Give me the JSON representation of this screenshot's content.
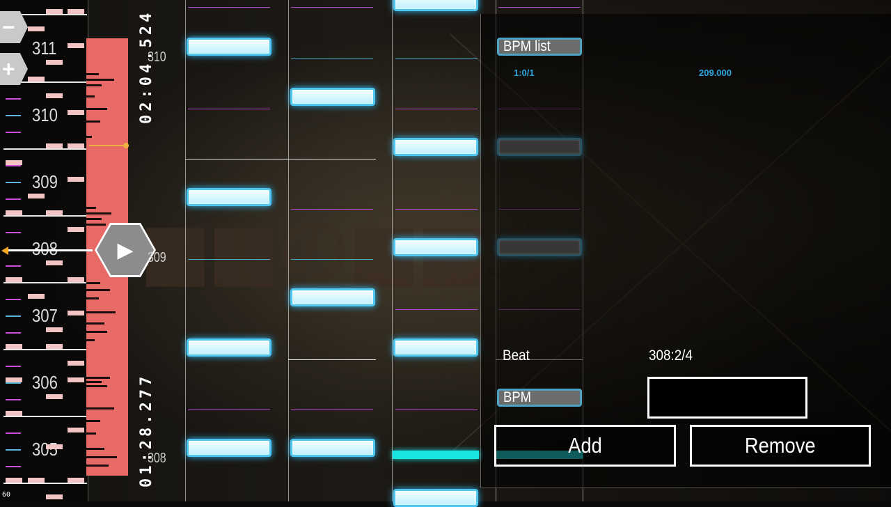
{
  "timeline": {
    "measures": [
      "311",
      "310",
      "309",
      "308",
      "307",
      "306",
      "305"
    ],
    "bottom_label": "60",
    "zoom_out_label": "−",
    "zoom_in_label": "+",
    "play_label": "▶"
  },
  "time_top": "02:04.524",
  "time_bottom": "01:28.277",
  "section_numbers": [
    "310",
    "309",
    "308"
  ],
  "bpm_list": {
    "title": "BPM list",
    "entries": [
      {
        "beat": "1:0/1",
        "bpm": "209.000"
      }
    ]
  },
  "form": {
    "beat_label": "Beat",
    "beat_value": "308:2/4",
    "bpm_label": "BPM",
    "bpm_value": "",
    "add_label": "Add",
    "remove_label": "Remove"
  },
  "colors": {
    "note_glow": "#4fc6f0",
    "waveform": "#e86a66",
    "cursor": "#f5a623",
    "accent": "#19e5e0"
  }
}
